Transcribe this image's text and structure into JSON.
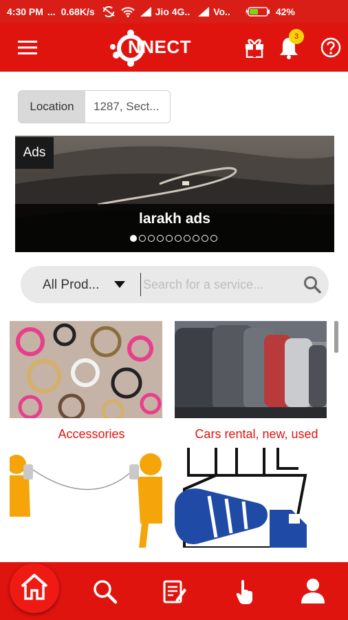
{
  "status_bar": {
    "time": "4:30 PM",
    "dots": "...",
    "speed": "0.68K/s",
    "carrier1": "Jio 4G..",
    "carrier2": "Vo..",
    "battery": "42%"
  },
  "app_bar": {
    "logo_text": "NNECT",
    "notification_count": "3"
  },
  "location": {
    "label": "Location",
    "value": "1287, Sect..."
  },
  "banner": {
    "tag": "Ads",
    "title": "larakh ads",
    "slide_count": 10,
    "active_slide": 1
  },
  "search": {
    "category": "All Prod...",
    "placeholder": "Search for a service..."
  },
  "categories": [
    {
      "label": "Accessories"
    },
    {
      "label": "Cars rental, new, used"
    },
    {
      "label": ""
    },
    {
      "label": ""
    }
  ],
  "bottom_nav": [
    "home-icon",
    "search-icon",
    "orders-icon",
    "tap-icon",
    "profile-icon"
  ],
  "colors": {
    "brand_red": "#e0140f",
    "badge_yellow": "#f5d20a"
  }
}
